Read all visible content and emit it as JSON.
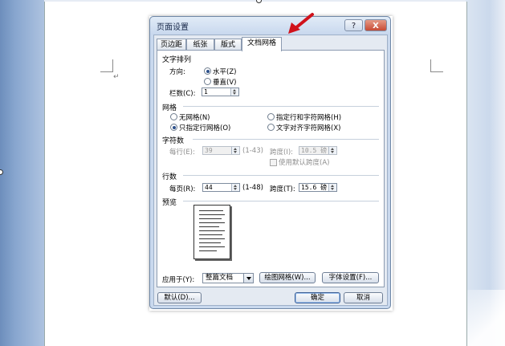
{
  "dialog": {
    "title": "页面设置",
    "help_label": "?",
    "close_label": "X",
    "tabs": [
      "页边距",
      "纸张",
      "版式",
      "文档网格"
    ],
    "active_tab": "文档网格",
    "text_direction": {
      "section": "文字排列",
      "direction_label": "方向:",
      "options": [
        "水平(Z)",
        "垂直(V)"
      ],
      "selected": "水平(Z)",
      "columns_label": "栏数(C):",
      "columns_value": "1"
    },
    "grid": {
      "section": "网格",
      "options": [
        "无网格(N)",
        "只指定行网格(O)",
        "指定行和字符网格(H)",
        "文字对齐字符网格(X)"
      ],
      "selected": "只指定行网格(O)"
    },
    "chars": {
      "section": "字符数",
      "per_line_label": "每行(E):",
      "per_line_value": "39",
      "per_line_range": "(1-43)",
      "pitch_label": "跨度(I):",
      "pitch_value": "10.5 磅",
      "default_pitch_label": "使用默认跨度(A)"
    },
    "lines": {
      "section": "行数",
      "per_page_label": "每页(R):",
      "per_page_value": "44",
      "per_page_range": "(1-48)",
      "pitch_label": "跨度(T):",
      "pitch_value": "15.6 磅"
    },
    "preview": {
      "section": "预览"
    },
    "apply_to_label": "应用于(Y):",
    "apply_to_value": "整篇文档",
    "drawing_grid_button": "绘图网格(W)...",
    "font_settings_button": "字体设置(F)...",
    "default_button": "默认(D)...",
    "ok_button": "确定",
    "cancel_button": "取消"
  },
  "document": {
    "paragraph_mark": "↵"
  },
  "colors": {
    "annotation_arrow": "#d0121b",
    "dialog_frame": "#c9d9ee"
  }
}
